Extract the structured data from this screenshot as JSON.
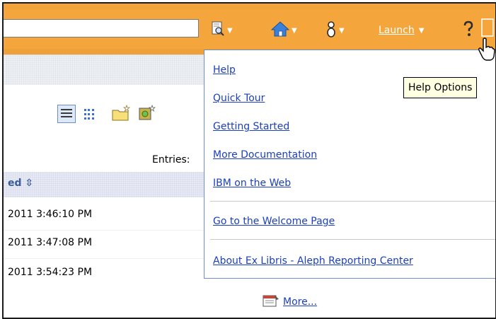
{
  "toolbar": {
    "search_value": "",
    "launch_label": "Launch",
    "caret": "▼"
  },
  "content": {
    "entries_label": "Entries:",
    "column_header": "ed ⇳",
    "rows": [
      {
        "time": "2011 3:46:10 PM"
      },
      {
        "time": "2011 3:47:08 PM"
      },
      {
        "time": "2011 3:54:23 PM"
      }
    ],
    "more_label": "More..."
  },
  "help_menu": {
    "items": [
      {
        "label": "Help"
      },
      {
        "label": "Quick Tour"
      },
      {
        "label": "Getting Started"
      },
      {
        "label": "More Documentation"
      },
      {
        "label": "IBM on the Web"
      },
      {
        "label": "Go to the Welcome Page"
      },
      {
        "label": "About Ex Libris - Aleph Reporting Center"
      }
    ]
  },
  "tooltip": {
    "text": "Help Options"
  },
  "colors": {
    "toolbar_orange": "#f4a53c",
    "link_blue": "#1a3fbf",
    "tooltip_bg": "#ffffe1",
    "menu_border": "#6f8fc0"
  }
}
